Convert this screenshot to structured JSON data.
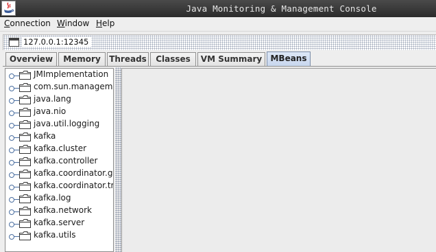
{
  "window": {
    "title": "Java Monitoring & Management Console",
    "icon": "java-console-icon"
  },
  "menu": {
    "items": [
      {
        "label": "Connection"
      },
      {
        "label": "Window"
      },
      {
        "label": "Help"
      }
    ]
  },
  "connection_frame": {
    "title": "127.0.0.1:12345",
    "icon": "window-icon"
  },
  "tabs": [
    {
      "label": "Overview",
      "selected": false
    },
    {
      "label": "Memory",
      "selected": false
    },
    {
      "label": "Threads",
      "selected": false
    },
    {
      "label": "Classes",
      "selected": false
    },
    {
      "label": "VM Summary",
      "selected": false
    },
    {
      "label": "MBeans",
      "selected": true
    }
  ],
  "mbean_tree": {
    "nodes": [
      {
        "label": "JMImplementation"
      },
      {
        "label": "com.sun.management"
      },
      {
        "label": "java.lang"
      },
      {
        "label": "java.nio"
      },
      {
        "label": "java.util.logging"
      },
      {
        "label": "kafka"
      },
      {
        "label": "kafka.cluster"
      },
      {
        "label": "kafka.controller"
      },
      {
        "label": "kafka.coordinator.group"
      },
      {
        "label": "kafka.coordinator.transaction"
      },
      {
        "label": "kafka.log"
      },
      {
        "label": "kafka.network"
      },
      {
        "label": "kafka.server"
      },
      {
        "label": "kafka.utils"
      }
    ]
  },
  "colors": {
    "selected_tab": "#c7d6ee",
    "tree_handle": "#4b6fa1",
    "titlebar": "#2b2b2b"
  }
}
